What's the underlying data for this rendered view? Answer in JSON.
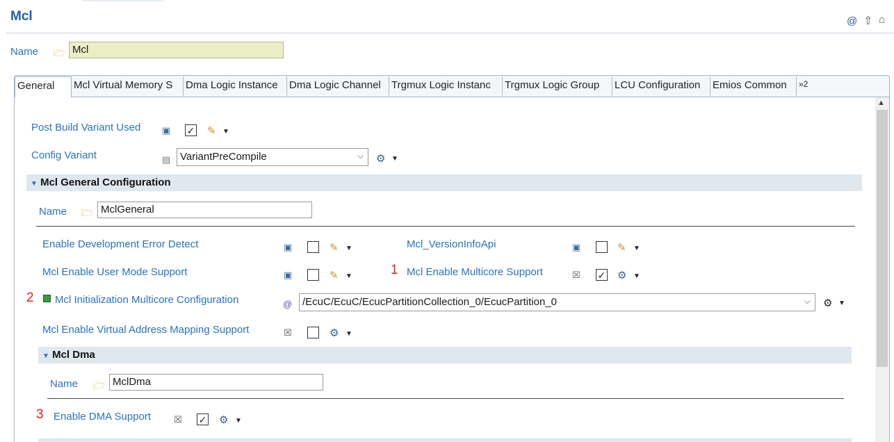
{
  "header": {
    "title": "Mcl",
    "name_label": "Name",
    "name_value": "Mcl"
  },
  "toolbar_icons": [
    "at-icon",
    "up-arrow-icon",
    "home-icon"
  ],
  "tabs": [
    {
      "label": "General",
      "active": true
    },
    {
      "label": "Mcl Virtual Memory S"
    },
    {
      "label": "Dma Logic Instance"
    },
    {
      "label": "Dma Logic Channel"
    },
    {
      "label": "Trgmux Logic Instanc"
    },
    {
      "label": "Trgmux Logic Group"
    },
    {
      "label": "LCU Configuration"
    },
    {
      "label": "Emios Common"
    },
    {
      "label": "»2"
    }
  ],
  "general": {
    "post_build_label": "Post Build Variant Used",
    "post_build_checked": true,
    "config_variant_label": "Config Variant",
    "config_variant_value": "VariantPreCompile"
  },
  "mcl_general": {
    "section_title": "Mcl General Configuration",
    "name_label": "Name",
    "name_value": "MclGeneral",
    "dev_error_label": "Enable Development Error Detect",
    "dev_error_checked": false,
    "version_info_label": "Mcl_VersionInfoApi",
    "version_info_checked": false,
    "user_mode_label": "Mcl Enable User Mode Support",
    "user_mode_checked": false,
    "multicore_label": "Mcl Enable Multicore Support",
    "multicore_checked": true,
    "init_multicore_label": "Mcl Initialization Multicore Configuration",
    "init_multicore_value": "/EcuC/EcuC/EcucPartitionCollection_0/EcucPartition_0",
    "virtual_addr_label": "Mcl Enable Virtual Address Mapping Support",
    "virtual_addr_checked": false
  },
  "mcl_dma": {
    "section_title": "Mcl Dma",
    "name_label": "Name",
    "name_value": "MclDma",
    "enable_dma_label": "Enable DMA Support",
    "enable_dma_checked": true
  },
  "annotations": {
    "marker_1": "1",
    "marker_2": "2",
    "marker_3": "3"
  },
  "colors": {
    "link": "#2a72c2",
    "annotation_red": "#e02020",
    "section_bg": "#dfe7ef",
    "name_field_bg": "#eceec7"
  }
}
